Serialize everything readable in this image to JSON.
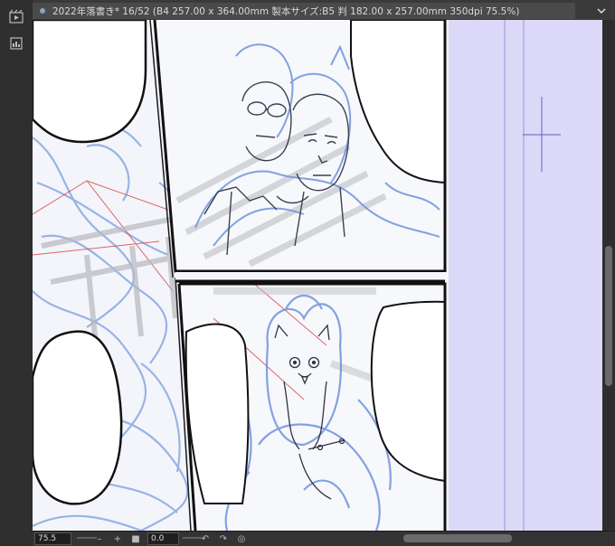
{
  "window": {
    "tab_title": "2022年落書き* 16/52 (B4 257.00 x 364.00mm 製本サイズ:B5 判 182.00 x 257.00mm 350dpi 75.5%)"
  },
  "statusbar": {
    "zoom_value": "75.5",
    "angle_value": "0.0"
  },
  "icons": {
    "tool1": "animation-icon",
    "tool2": "layer-panel-icon",
    "menu": "chevron-down-icon"
  },
  "colors": {
    "canvas_bg": "#dcd8f8",
    "sketch_blue": "#6f93dc",
    "panel_border": "#111111",
    "guide_red": "#d33"
  }
}
